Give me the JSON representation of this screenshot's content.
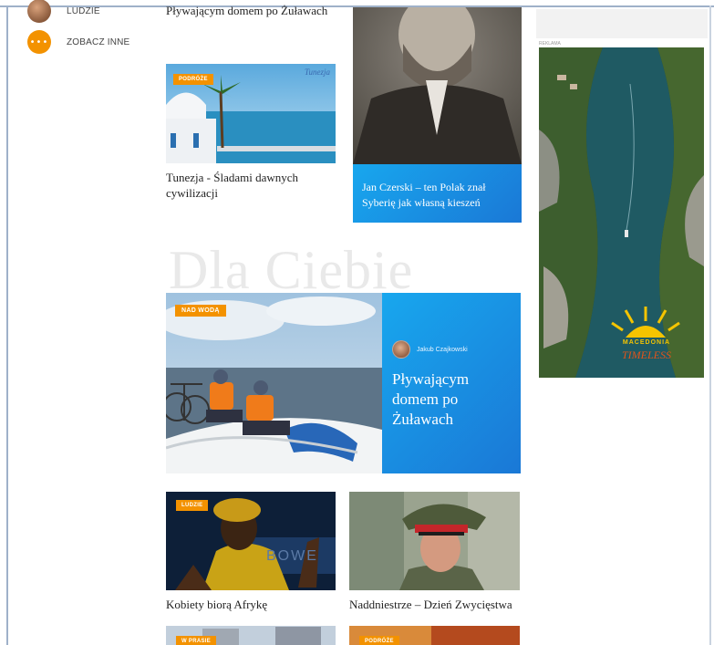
{
  "nav": {
    "people_label": "LUDZIE",
    "more_icon_text": "•••",
    "more_label": "ZOBACZ INNE"
  },
  "top_caption": "Pływającym domem po Żuławach",
  "cards": {
    "tunezja": {
      "badge": "PODRÓŻE",
      "caption_line1": "Tunezja - Śladami dawnych",
      "caption_line2": "cywilizacji",
      "brand": "Tunezja"
    },
    "czerski": {
      "title_line1": "Jan Czerski – ten Polak znał",
      "title_line2": "Syberię jak własną kieszeń"
    },
    "featured": {
      "badge": "NAD WODĄ",
      "author": "Jakub Czajkowski",
      "title_line1": "Pływającym",
      "title_line2": "domem po",
      "title_line3": "Żuławach"
    },
    "afryka": {
      "badge": "LUDZIE",
      "caption": "Kobiety biorą Afrykę",
      "bg_text": "BOWE"
    },
    "naddniestrze": {
      "caption": "Naddniestrze – Dzień Zwycięstwa"
    },
    "bottom_left": {
      "badge": "W PRASIE"
    },
    "bottom_right": {
      "badge": "PODRÓŻE"
    }
  },
  "section_watermark": "Dla Ciebie",
  "ad": {
    "label": "REKLAMA",
    "brand_line1": "MACEDONIA",
    "brand_line2": "TIMELESS"
  },
  "colors": {
    "accent_orange": "#f39200",
    "panel_blue": "#1a90e6"
  }
}
